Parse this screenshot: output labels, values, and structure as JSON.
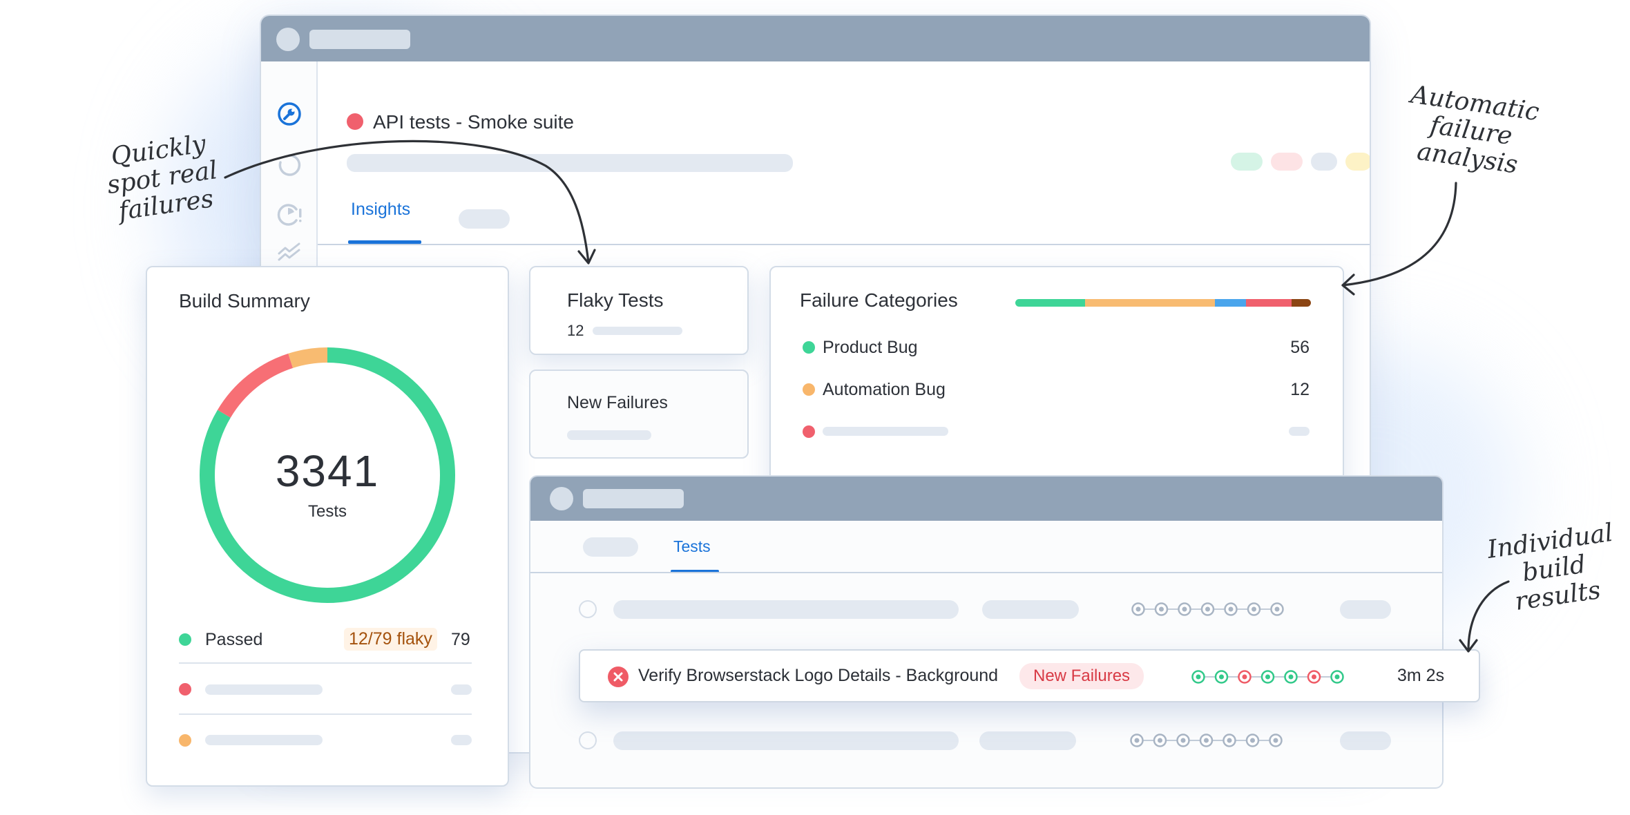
{
  "main_window": {
    "page_title": "API tests - Smoke suite",
    "tabs": [
      {
        "label": "Insights",
        "active": true
      }
    ],
    "status_pill_colors": [
      "#d5f4e6",
      "#fde3e5",
      "#e3e9f1",
      "#fdf2c6"
    ]
  },
  "build_summary": {
    "title": "Build Summary",
    "total": "3341",
    "total_label": "Tests",
    "donut_segments": [
      {
        "name": "passed",
        "fraction": 0.835,
        "color": "#3ed597"
      },
      {
        "name": "failed",
        "fraction": 0.115,
        "color": "#f76f75"
      },
      {
        "name": "flaky",
        "fraction": 0.05,
        "color": "#f8bb71"
      }
    ],
    "legend": [
      {
        "label": "Passed",
        "flaky": "12/79 flaky",
        "count": "79",
        "color": "#3ed597"
      },
      {
        "color": "#f0606d"
      },
      {
        "color": "#f8b66b"
      }
    ]
  },
  "flaky_tests": {
    "title": "Flaky Tests",
    "count": "12"
  },
  "new_failures": {
    "title": "New Failures"
  },
  "failure_categories": {
    "title": "Failure Categories",
    "bar_segments": [
      {
        "fraction": 0.235,
        "color": "#3ed597"
      },
      {
        "fraction": 0.44,
        "color": "#f8bb71"
      },
      {
        "fraction": 0.105,
        "color": "#4aa5ec"
      },
      {
        "fraction": 0.155,
        "color": "#f0606d"
      },
      {
        "fraction": 0.065,
        "color": "#8b4513"
      }
    ],
    "items": [
      {
        "label": "Product Bug",
        "count": "56",
        "color": "#3ed597"
      },
      {
        "label": "Automation Bug",
        "count": "12",
        "color": "#f8b66b"
      },
      {
        "color": "#f0606d"
      }
    ]
  },
  "tests_window": {
    "tabs": [
      {
        "label": "Tests",
        "active": true
      }
    ],
    "highlighted_row": {
      "name": "Verify Browserstack Logo Details - Background",
      "badge": "New Failures",
      "duration": "3m 2s",
      "history": [
        "pass",
        "pass",
        "fail",
        "pass",
        "pass",
        "fail",
        "pass"
      ]
    }
  },
  "annotations": {
    "quickly_spot": [
      "Quickly",
      "spot real",
      "failures"
    ],
    "automatic": [
      "Automatic",
      "failure",
      "analysis"
    ],
    "individual": [
      "Individual",
      "build",
      "results"
    ]
  }
}
